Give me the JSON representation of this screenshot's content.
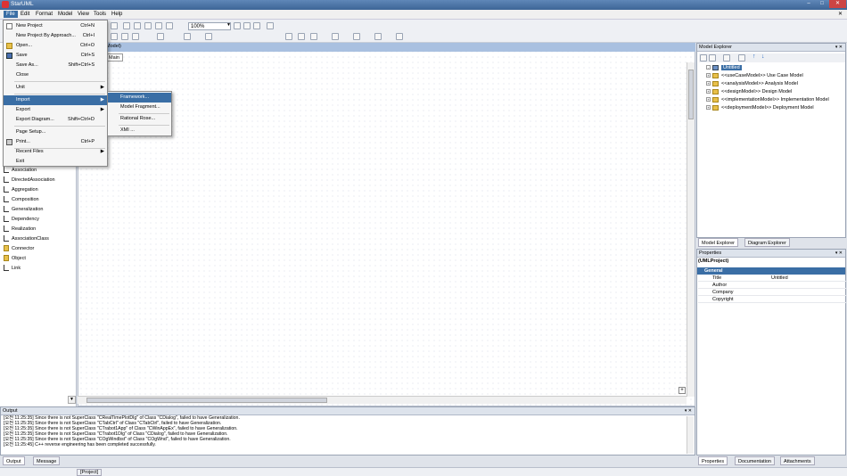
{
  "window": {
    "title": "StarUML",
    "controls": [
      "–",
      "□",
      "✕"
    ]
  },
  "menubar": [
    "File",
    "Edit",
    "Format",
    "Model",
    "View",
    "Tools",
    "Help"
  ],
  "toolbar": {
    "zoom": "100%"
  },
  "file_menu": [
    {
      "label": "New Project",
      "shortcut": "Ctrl+N",
      "icon": "new-icon"
    },
    {
      "label": "New Project By Approach...",
      "shortcut": "Ctrl+I"
    },
    {
      "label": "Open...",
      "shortcut": "Ctrl+O",
      "icon": "open-icon"
    },
    {
      "label": "Save",
      "shortcut": "Ctrl+S",
      "icon": "save-icon"
    },
    {
      "label": "Save As...",
      "shortcut": "Shift+Ctrl+S"
    },
    {
      "label": "Close",
      "shortcut": ""
    },
    {
      "label": "Unit",
      "submenu": true
    },
    {
      "label": "Import",
      "submenu": true,
      "highlighted": true
    },
    {
      "label": "Export",
      "submenu": true
    },
    {
      "label": "Export Diagram...",
      "shortcut": "Shift+Ctrl+D"
    },
    {
      "label": "Page Setup...",
      "shortcut": ""
    },
    {
      "label": "Print...",
      "shortcut": "Ctrl+P",
      "icon": "print-icon"
    },
    {
      "label": "Recent Files",
      "submenu": true
    },
    {
      "label": "Exit",
      "shortcut": ""
    }
  ],
  "import_submenu": [
    "Framework...",
    "Model Fragment...",
    "Rational Rose...",
    "XMI ..."
  ],
  "palette": [
    "Association",
    "DirectedAssociation",
    "Aggregation",
    "Composition",
    "Generalization",
    "Dependency",
    "Realization",
    "AssociationClass",
    "Connector",
    "Object",
    "Link"
  ],
  "diagram": {
    "header": "Model)",
    "tab": "Main"
  },
  "model_explorer": {
    "title": "Model Explorer",
    "root": "Untitled",
    "items": [
      "<<useCaseModel>> Use Case Model",
      "<<analysisModel>> Analysis Model",
      "<<designModel>> Design Model",
      "<<implementationModel>> Implementation Model",
      "<<deploymentModel>> Deployment Model"
    ],
    "tabs": [
      "Model Explorer",
      "Diagram Explorer"
    ]
  },
  "properties": {
    "title": "Properties",
    "object": "(UMLProject)",
    "section": "General",
    "rows": [
      {
        "name": "Title",
        "value": "Untitled"
      },
      {
        "name": "Author",
        "value": ""
      },
      {
        "name": "Company",
        "value": ""
      },
      {
        "name": "Copyright",
        "value": ""
      }
    ],
    "tabs": [
      "Properties",
      "Documentation",
      "Attachments"
    ]
  },
  "output": {
    "title": "Output",
    "lines": [
      "[오전 11:25:35]  Since there is not SuperClass \"CRealTimePlotDlg\" of Class \"CDialog\", failed to have Generalization.",
      "[오전 11:25:35]  Since there is not SuperClass \"CTabCtrl\" of Class \"CTabCtrl\", failed to have Generalization.",
      "[오전 11:25:35]  Since there is not SuperClass \"CTrabot1App\" of Class \"CWinAppEx\", failed to have Generalization.",
      "[오전 11:25:35]  Since there is not SuperClass \"CTrabot1Dlg\" of Class \"CDialog\", failed to have Generalization.",
      "[오전 11:25:35]  Since there is not SuperClass \"COgWindbst\" of Class \"COgWnd\", failed to have Generalization.",
      "[오전 11:25:45]  C++ reverse engineering has been completed successfully."
    ],
    "tabs": [
      "Output",
      "Message"
    ]
  },
  "status": {
    "text": "[Project]"
  }
}
